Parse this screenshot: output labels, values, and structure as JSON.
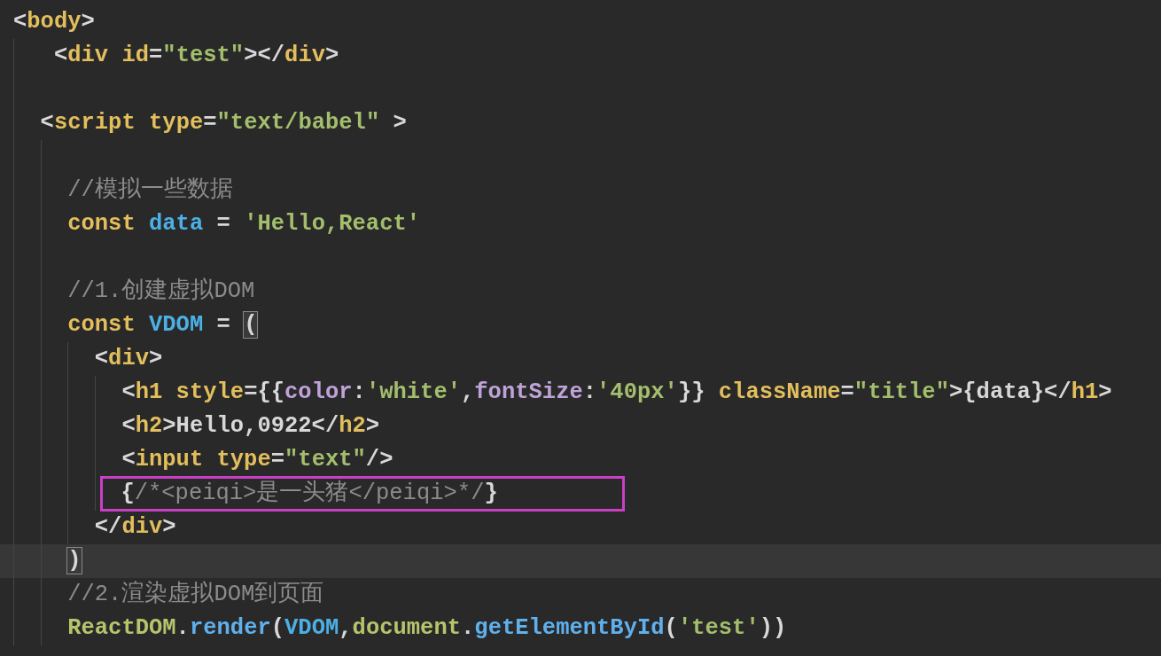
{
  "editor": {
    "lines": [
      {
        "current": false,
        "boxed": false,
        "tokens": [
          {
            "text": "<",
            "kind": "p"
          },
          {
            "text": "body",
            "kind": "tag"
          },
          {
            "text": ">",
            "kind": "p"
          }
        ],
        "children": [
          {
            "current": false,
            "boxed": false,
            "tokens": [
              {
                "text": " <",
                "kind": "p"
              },
              {
                "text": "div",
                "kind": "tag"
              },
              {
                "text": " id",
                "kind": "attr"
              },
              {
                "text": "=",
                "kind": "p"
              },
              {
                "text": "\"test\"",
                "kind": "str"
              },
              {
                "text": "></",
                "kind": "p"
              },
              {
                "text": "div",
                "kind": "tag"
              },
              {
                "text": ">",
                "kind": "p"
              }
            ]
          },
          {
            "current": false,
            "boxed": false
          },
          {
            "current": false,
            "boxed": false,
            "tokens": [
              {
                "text": "<",
                "kind": "p"
              },
              {
                "text": "script",
                "kind": "tag"
              },
              {
                "text": " type",
                "kind": "attr"
              },
              {
                "text": "=",
                "kind": "p"
              },
              {
                "text": "\"text/babel\"",
                "kind": "str"
              },
              {
                "text": " >",
                "kind": "p"
              }
            ],
            "children": [
              {
                "current": false,
                "boxed": false
              },
              {
                "current": false,
                "boxed": false,
                "tokens": [
                  {
                    "text": "//模拟一些数据",
                    "kind": "com"
                  }
                ]
              },
              {
                "current": false,
                "boxed": false,
                "tokens": [
                  {
                    "text": "const",
                    "kind": "kw"
                  },
                  {
                    "text": " data",
                    "kind": "var"
                  },
                  {
                    "text": " = ",
                    "kind": "p"
                  },
                  {
                    "text": "'Hello,React'",
                    "kind": "str"
                  }
                ]
              },
              {
                "current": false,
                "boxed": false
              },
              {
                "current": false,
                "boxed": false,
                "tokens": [
                  {
                    "text": "//1.创建虚拟DOM",
                    "kind": "com"
                  }
                ]
              },
              {
                "current": false,
                "boxed": false,
                "tokens": [
                  {
                    "text": "const",
                    "kind": "kw"
                  },
                  {
                    "text": " VDOM",
                    "kind": "var"
                  },
                  {
                    "text": " = ",
                    "kind": "p"
                  },
                  {
                    "text": "(",
                    "kind": "match"
                  }
                ],
                "children": [
                  {
                    "current": false,
                    "boxed": false,
                    "tokens": [
                      {
                        "text": "<",
                        "kind": "p"
                      },
                      {
                        "text": "div",
                        "kind": "tag"
                      },
                      {
                        "text": ">",
                        "kind": "p"
                      }
                    ],
                    "children": [
                      {
                        "current": false,
                        "boxed": false,
                        "tokens": [
                          {
                            "text": "<",
                            "kind": "p"
                          },
                          {
                            "text": "h1",
                            "kind": "tag"
                          },
                          {
                            "text": " style",
                            "kind": "attr"
                          },
                          {
                            "text": "={{",
                            "kind": "p"
                          },
                          {
                            "text": "color",
                            "kind": "prop"
                          },
                          {
                            "text": ":",
                            "kind": "p"
                          },
                          {
                            "text": "'white'",
                            "kind": "str"
                          },
                          {
                            "text": ",",
                            "kind": "p"
                          },
                          {
                            "text": "fontSize",
                            "kind": "prop"
                          },
                          {
                            "text": ":",
                            "kind": "p"
                          },
                          {
                            "text": "'40px'",
                            "kind": "str"
                          },
                          {
                            "text": "}} ",
                            "kind": "p"
                          },
                          {
                            "text": "className",
                            "kind": "attr"
                          },
                          {
                            "text": "=",
                            "kind": "p"
                          },
                          {
                            "text": "\"title\"",
                            "kind": "str"
                          },
                          {
                            "text": ">{data}</",
                            "kind": "p"
                          },
                          {
                            "text": "h1",
                            "kind": "tag"
                          },
                          {
                            "text": ">",
                            "kind": "p"
                          }
                        ]
                      },
                      {
                        "current": false,
                        "boxed": false,
                        "tokens": [
                          {
                            "text": "<",
                            "kind": "p"
                          },
                          {
                            "text": "h2",
                            "kind": "tag"
                          },
                          {
                            "text": ">Hello,0922</",
                            "kind": "p"
                          },
                          {
                            "text": "h2",
                            "kind": "tag"
                          },
                          {
                            "text": ">",
                            "kind": "p"
                          }
                        ]
                      },
                      {
                        "current": false,
                        "boxed": false,
                        "tokens": [
                          {
                            "text": "<",
                            "kind": "p"
                          },
                          {
                            "text": "input",
                            "kind": "tag"
                          },
                          {
                            "text": " type",
                            "kind": "attr"
                          },
                          {
                            "text": "=",
                            "kind": "p"
                          },
                          {
                            "text": "\"text\"",
                            "kind": "str"
                          },
                          {
                            "text": "/>",
                            "kind": "p"
                          }
                        ]
                      },
                      {
                        "current": false,
                        "boxed": true,
                        "tokens": [
                          {
                            "text": "{",
                            "kind": "p"
                          },
                          {
                            "text": "/*<peiqi>是一头猪</peiqi>*/",
                            "kind": "com"
                          },
                          {
                            "text": "}",
                            "kind": "p"
                          }
                        ]
                      }
                    ]
                  },
                  {
                    "current": false,
                    "boxed": false,
                    "tokens": [
                      {
                        "text": "</",
                        "kind": "p"
                      },
                      {
                        "text": "div",
                        "kind": "tag"
                      },
                      {
                        "text": ">",
                        "kind": "p"
                      }
                    ]
                  }
                ]
              },
              {
                "current": true,
                "boxed": false,
                "tokens": [
                  {
                    "text": ")",
                    "kind": "match"
                  }
                ]
              },
              {
                "current": false,
                "boxed": false,
                "tokens": [
                  {
                    "text": "//2.渲染虚拟DOM到页面",
                    "kind": "com"
                  }
                ]
              },
              {
                "current": false,
                "boxed": false,
                "tokens": [
                  {
                    "text": "ReactDOM",
                    "kind": "obj"
                  },
                  {
                    "text": ".",
                    "kind": "p"
                  },
                  {
                    "text": "render",
                    "kind": "fn"
                  },
                  {
                    "text": "(",
                    "kind": "p"
                  },
                  {
                    "text": "VDOM",
                    "kind": "var"
                  },
                  {
                    "text": ",",
                    "kind": "p"
                  },
                  {
                    "text": "document",
                    "kind": "obj"
                  },
                  {
                    "text": ".",
                    "kind": "p"
                  },
                  {
                    "text": "getElementById",
                    "kind": "fn"
                  },
                  {
                    "text": "(",
                    "kind": "p"
                  },
                  {
                    "text": "'test'",
                    "kind": "str"
                  },
                  {
                    "text": "))",
                    "kind": "p"
                  }
                ]
              }
            ]
          }
        ]
      }
    ]
  }
}
